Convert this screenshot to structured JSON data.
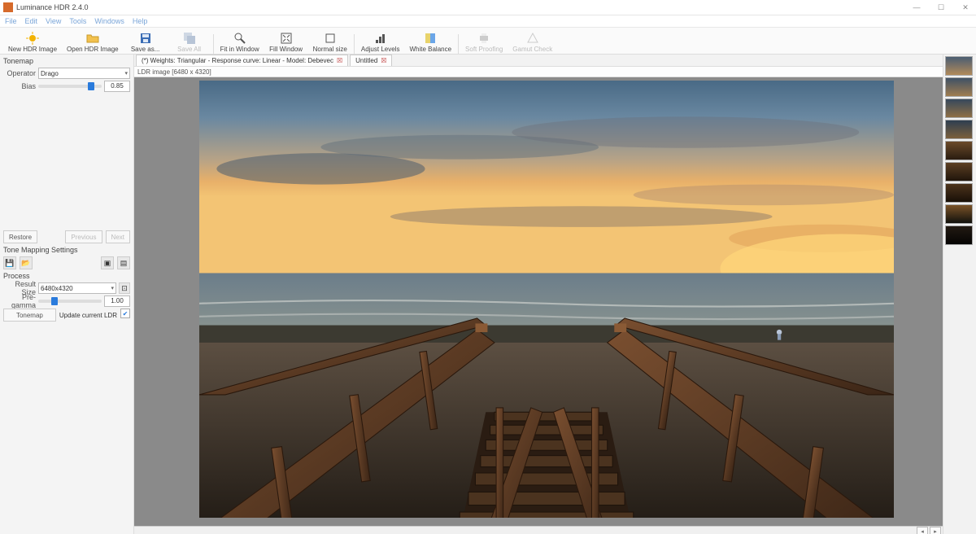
{
  "window": {
    "title": "Luminance HDR 2.4.0"
  },
  "menus": [
    "File",
    "Edit",
    "View",
    "Tools",
    "Windows",
    "Help"
  ],
  "toolbar": {
    "new_hdr": "New HDR Image",
    "open_hdr": "Open HDR Image",
    "save_as": "Save as...",
    "save_all": "Save All",
    "fit_window": "Fit in Window",
    "fill_window": "Fill Window",
    "normal_size": "Normal size",
    "adjust_levels": "Adjust Levels",
    "white_balance": "White Balance",
    "soft_proofing": "Soft Proofing",
    "gamut_check": "Gamut Check"
  },
  "left": {
    "tonemap_title": "Tonemap",
    "operator_label": "Operator",
    "operator_value": "Drago",
    "bias_label": "Bias",
    "bias_value": "0.85",
    "restore": "Restore",
    "previous": "Previous",
    "next": "Next",
    "tm_settings": "Tone Mapping Settings",
    "process": "Process",
    "result_size_label": "Result Size",
    "result_size_value": "6480x4320",
    "lock_tip": "×",
    "pregamma_label": "Pre-gamma",
    "pregamma_value": "1.00",
    "tonemap_btn": "Tonemap",
    "update_ldr": "Update current LDR"
  },
  "tabs": {
    "doc1": "(*) Weights: Triangular - Response curve: Linear - Model: Debevec",
    "doc2": "Untitled"
  },
  "info": {
    "ldr": "LDR image [6480 x 4320]"
  },
  "thumbs": {
    "count": 9
  },
  "scene": {
    "description": "Wooden boardwalk stairs leading down to a sandy beach at sunset; ocean horizon with orange and blue sky, scattered clouds."
  }
}
